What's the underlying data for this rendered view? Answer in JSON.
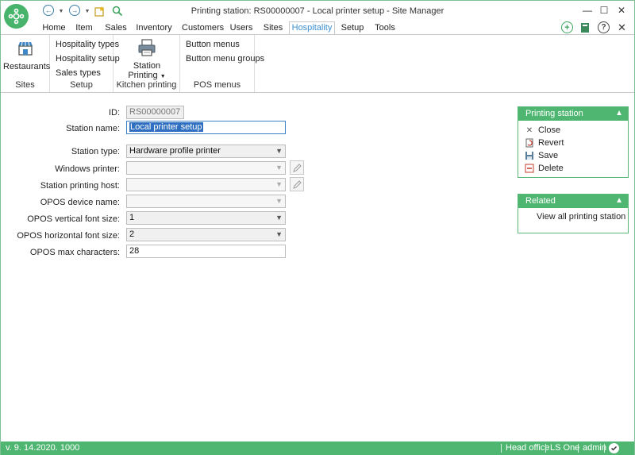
{
  "window": {
    "title": "Printing station: RS00000007 - Local printer setup - Site Manager"
  },
  "menu_tabs": [
    "Home",
    "Item",
    "Sales",
    "Inventory",
    "Customers",
    "Users",
    "Sites",
    "Hospitality",
    "Setup",
    "Tools"
  ],
  "active_tab": "Hospitality",
  "ribbon": {
    "sites": {
      "button": "Restaurants",
      "label": "Sites"
    },
    "setup": {
      "items": [
        "Hospitality types",
        "Hospitality setup",
        "Sales types"
      ],
      "label": "Setup"
    },
    "kitchen": {
      "button_line1": "Station",
      "button_line2": "Printing",
      "label": "Kitchen printing"
    },
    "pos": {
      "items": [
        "Button menus",
        "Button menu groups"
      ],
      "label": "POS menus"
    }
  },
  "form": {
    "id_label": "ID:",
    "id_value": "RS00000007",
    "station_name_label": "Station name:",
    "station_name_value": "Local printer setup",
    "station_type_label": "Station type:",
    "station_type_value": "Hardware profile printer",
    "windows_printer_label": "Windows printer:",
    "windows_printer_value": "",
    "printing_host_label": "Station printing host:",
    "printing_host_value": "",
    "opos_device_label": "OPOS device name:",
    "opos_device_value": "",
    "opos_vfont_label": "OPOS vertical font size:",
    "opos_vfont_value": "1",
    "opos_hfont_label": "OPOS horizontal font size:",
    "opos_hfont_value": "2",
    "opos_maxchars_label": "OPOS max characters:",
    "opos_maxchars_value": "28"
  },
  "printing_panel": {
    "title": "Printing station",
    "actions": [
      "Close",
      "Revert",
      "Save",
      "Delete"
    ]
  },
  "related_panel": {
    "title": "Related",
    "link": "View all printing station"
  },
  "statusbar": {
    "version": "v. 9. 14.2020. 1000",
    "office": "Head office",
    "product": "LS One",
    "user": "admin"
  },
  "colors": {
    "accent_green": "#4fb671",
    "active_tab_text": "#3b8fd0",
    "selection": "#2f6fc2"
  }
}
